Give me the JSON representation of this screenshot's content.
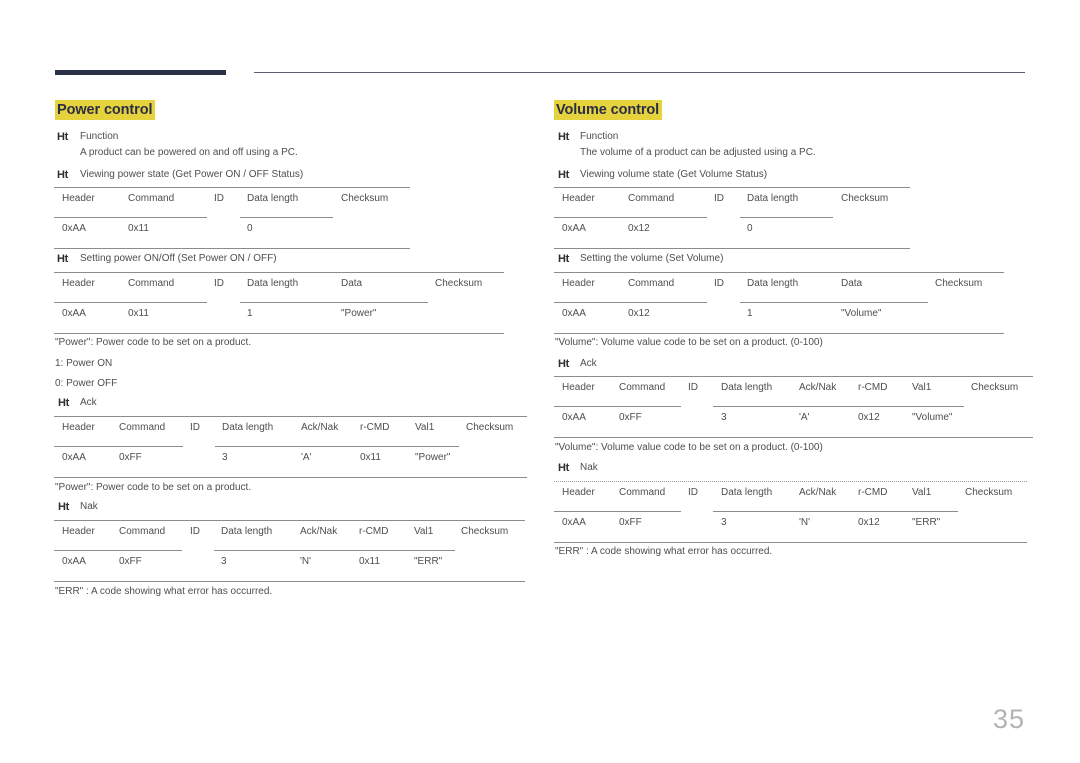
{
  "page": {
    "number": "35"
  },
  "power_control": {
    "title": "Power control",
    "bullet": "Ht",
    "function_label": "Function",
    "function_desc": "A product can be powered on and off using a PC.",
    "get_status": {
      "label": "Viewing power state (Get Power ON / OFF Status)",
      "table": {
        "columns": [
          "Header",
          "Command",
          "ID",
          "Data length",
          "Checksum"
        ],
        "row": [
          "0xAA",
          "0x11",
          "",
          "0",
          ""
        ]
      }
    },
    "set_power": {
      "label": "Setting power ON/Off (Set Power ON / OFF)",
      "table": {
        "columns": [
          "Header",
          "Command",
          "ID",
          "Data length",
          "Data",
          "Checksum"
        ],
        "row": [
          "0xAA",
          "0x11",
          "",
          "1",
          "\"Power\"",
          ""
        ]
      }
    },
    "notes": [
      "\"Power\": Power code to be set on a product.",
      "1: Power ON",
      "0: Power OFF"
    ],
    "ack": {
      "label": "Ack",
      "table": {
        "columns": [
          "Header",
          "Command",
          "ID",
          "Data length",
          "Ack/Nak",
          "r-CMD",
          "Val1",
          "Checksum"
        ],
        "row": [
          "0xAA",
          "0xFF",
          "",
          "3",
          "'A'",
          "0x11",
          "\"Power\"",
          ""
        ]
      },
      "note": "\"Power\": Power code to be set on a product."
    },
    "nak": {
      "label": "Nak",
      "table": {
        "columns": [
          "Header",
          "Command",
          "ID",
          "Data length",
          "Ack/Nak",
          "r-CMD",
          "Val1",
          "Checksum"
        ],
        "row": [
          "0xAA",
          "0xFF",
          "",
          "3",
          "'N'",
          "0x11",
          "\"ERR\"",
          ""
        ]
      },
      "note": "\"ERR\" : A code showing what error has occurred."
    }
  },
  "volume_control": {
    "title": "Volume control",
    "bullet": "Ht",
    "function_label": "Function",
    "function_desc": "The volume of a product can be adjusted using a PC.",
    "get_status": {
      "label": "Viewing volume state (Get Volume Status)",
      "table": {
        "columns": [
          "Header",
          "Command",
          "ID",
          "Data length",
          "Checksum"
        ],
        "row": [
          "0xAA",
          "0x12",
          "",
          "0",
          ""
        ]
      }
    },
    "set_volume": {
      "label": "Setting the volume (Set Volume)",
      "table": {
        "columns": [
          "Header",
          "Command",
          "ID",
          "Data length",
          "Data",
          "Checksum"
        ],
        "row": [
          "0xAA",
          "0x12",
          "",
          "1",
          "\"Volume\"",
          ""
        ]
      },
      "note": "\"Volume\": Volume value code to be set on a product. (0-100)"
    },
    "ack": {
      "label": "Ack",
      "table": {
        "columns": [
          "Header",
          "Command",
          "ID",
          "Data length",
          "Ack/Nak",
          "r-CMD",
          "Val1",
          "Checksum"
        ],
        "row": [
          "0xAA",
          "0xFF",
          "",
          "3",
          "'A'",
          "0x12",
          "\"Volume\"",
          ""
        ]
      },
      "note": "\"Volume\": Volume value code to be set on a product. (0-100)"
    },
    "nak": {
      "label": "Nak",
      "table": {
        "columns": [
          "Header",
          "Command",
          "ID",
          "Data length",
          "Ack/Nak",
          "r-CMD",
          "Val1",
          "Checksum"
        ],
        "row": [
          "0xAA",
          "0xFF",
          "",
          "3",
          "'N'",
          "0x12",
          "\"ERR\"",
          ""
        ]
      },
      "note": "\"ERR\" : A code showing what error has occurred."
    }
  }
}
